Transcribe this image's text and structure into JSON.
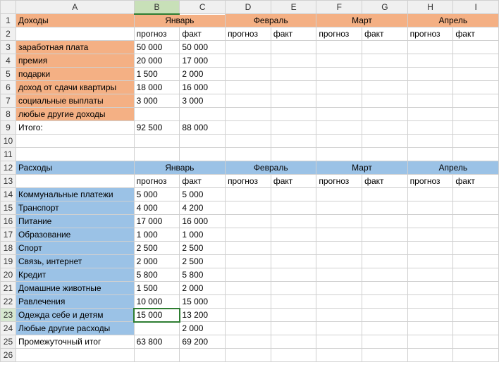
{
  "columns": [
    "A",
    "B",
    "C",
    "D",
    "E",
    "F",
    "G",
    "H",
    "I"
  ],
  "rows": [
    1,
    2,
    3,
    4,
    5,
    6,
    7,
    8,
    9,
    10,
    11,
    12,
    13,
    14,
    15,
    16,
    17,
    18,
    19,
    20,
    21,
    22,
    23,
    24,
    25,
    26
  ],
  "selected_col": "B",
  "selected_row": 23,
  "income": {
    "title": "Доходы",
    "months": [
      "Январь",
      "Февраль",
      "Март",
      "Апрель"
    ],
    "sub": {
      "forecast": "прогноз",
      "fact": "факт"
    },
    "items": [
      {
        "label": "заработная плата",
        "f": "50 000",
        "a": "50 000"
      },
      {
        "label": "премия",
        "f": "20 000",
        "a": "17 000"
      },
      {
        "label": "подарки",
        "f": "1 500",
        "a": "2 000"
      },
      {
        "label": "доход от сдачи квартиры",
        "f": "18 000",
        "a": "16 000"
      },
      {
        "label": "социальные выплаты",
        "f": "3 000",
        "a": "3 000"
      },
      {
        "label": "любые другие доходы",
        "f": "",
        "a": ""
      }
    ],
    "total_label": "Итого:",
    "total_f": "92 500",
    "total_a": "88 000"
  },
  "expenses": {
    "title": "Расходы",
    "months": [
      "Январь",
      "Февраль",
      "Март",
      "Апрель"
    ],
    "sub": {
      "forecast": "прогноз",
      "fact": "факт"
    },
    "items": [
      {
        "label": "Коммунальные платежи",
        "f": "5 000",
        "a": "5 000"
      },
      {
        "label": "Транспорт",
        "f": "4 000",
        "a": "4 200"
      },
      {
        "label": "Питание",
        "f": "17 000",
        "a": "16 000"
      },
      {
        "label": "Образование",
        "f": "1 000",
        "a": "1 000"
      },
      {
        "label": "Спорт",
        "f": "2 500",
        "a": "2 500"
      },
      {
        "label": "Связь, интернет",
        "f": "2 000",
        "a": "2 500"
      },
      {
        "label": "Кредит",
        "f": "5 800",
        "a": "5 800"
      },
      {
        "label": "Домашние животные",
        "f": "1 500",
        "a": "2 000"
      },
      {
        "label": "Равлечения",
        "f": "10 000",
        "a": "15 000"
      },
      {
        "label": "Одежда себе и детям",
        "f": "15 000",
        "a": "13 200"
      },
      {
        "label": "Любые другие расходы",
        "f": "",
        "a": "2 000"
      }
    ],
    "total_label": "Промежуточный итог",
    "total_f": "63 800",
    "total_a": "69 200"
  }
}
